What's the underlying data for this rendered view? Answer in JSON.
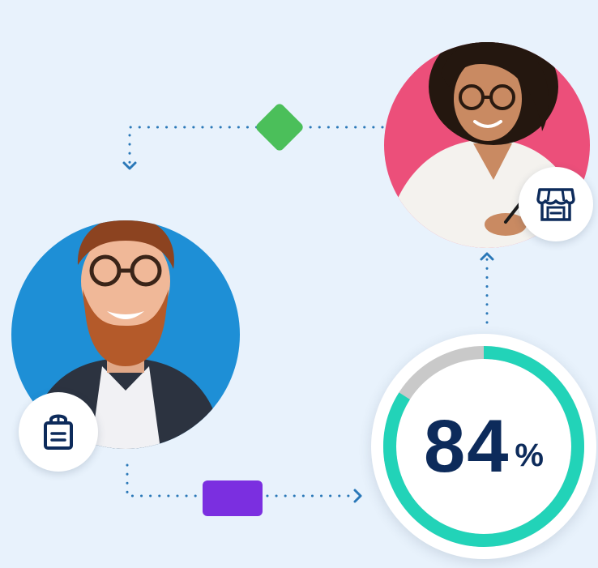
{
  "progress": {
    "value": "84",
    "unit": "%",
    "fraction": 0.84
  },
  "colors": {
    "background": "#e8f2fc",
    "connector_dots": "#2a78b8",
    "diamond": "#4bbf5a",
    "rectangle": "#7b2fe0",
    "gauge_fill": "#22d3b8",
    "gauge_track": "#c9c9c9",
    "gauge_text": "#0d2b5b",
    "man_avatar_bg": "#1e8fd6",
    "woman_avatar_bg": "#ec4f7a"
  },
  "icons": {
    "buyer_badge": "shopping-bag-icon",
    "seller_badge": "storefront-icon"
  }
}
